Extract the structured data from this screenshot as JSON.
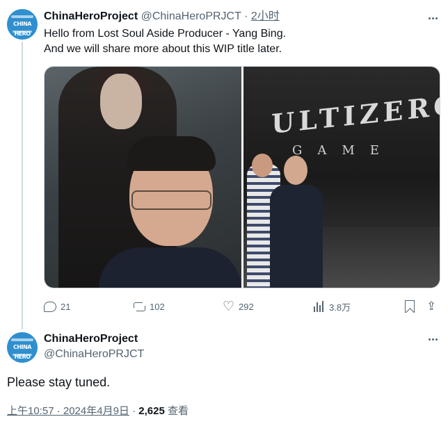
{
  "tweet1": {
    "author_name": "ChinaHeroProject",
    "handle": "@ChinaHeroPRJCT",
    "separator": "·",
    "time": "2小时",
    "text_line1": "Hello from Lost Soul Aside Producer - Yang Bing.",
    "text_line2": "And we will share more about this WIP title later.",
    "media_sign": "ULTIZERO",
    "media_sign2": "GAME",
    "stats": {
      "replies": "21",
      "retweets": "102",
      "likes": "292",
      "views": "3.8万"
    }
  },
  "tweet2": {
    "author_name": "ChinaHeroProject",
    "handle": "@ChinaHeroPRJCT",
    "text": "Please stay tuned.",
    "timestamp": "上午10:57 · 2024年4月9日",
    "separator": "·",
    "view_count": "2,625",
    "view_label": "查看"
  },
  "avatar_text": "CHINA HERO",
  "colors": {
    "avatar_bg": "#2f8fcf",
    "text_primary": "#0f1419",
    "text_secondary": "#536471",
    "border": "#cfd9de"
  },
  "icons": {
    "reply": "reply-icon",
    "retweet": "retweet-icon",
    "like": "heart-icon",
    "views": "views-chart-icon",
    "bookmark": "bookmark-icon",
    "share": "share-icon",
    "more": "more-dots-icon"
  }
}
